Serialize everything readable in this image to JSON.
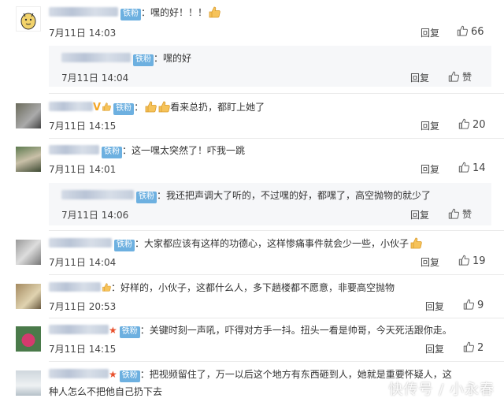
{
  "badge_label": "铁粉",
  "reply_label": "回复",
  "like_label": "赞",
  "comments": [
    {
      "text": "：嘿的好！！！",
      "time": "7月11日 14:03",
      "likes": "66"
    },
    {
      "text": "：嘿的好",
      "time": "7月11日 14:04"
    },
    {
      "text": "看来总扔，都盯上她了",
      "time": "7月11日 14:15",
      "likes": "20"
    },
    {
      "text": "：这一嘿太突然了！吓我一跳",
      "time": "7月11日 14:01",
      "likes": "14"
    },
    {
      "text": "：我还把声调大了听的，不过嘿的好，都嘿了，高空抛物的就少了",
      "time": "7月11日 14:06"
    },
    {
      "text": "：大家都应该有这样的功德心，这样惨痛事件就会少一些，小伙子",
      "time": "7月11日 14:04",
      "likes": "19"
    },
    {
      "text": "：好样的，小伙子，这都什么人，多下趟楼都不愿意，非要高空抛物",
      "time": "7月11日 20:53",
      "likes": "9"
    },
    {
      "text": "：关键时刻一声吼，吓得对方手一抖。扭头一看是帅哥，今天死活跟你走。",
      "time": "7月11日 14:15",
      "likes": "2"
    },
    {
      "text_line1": "：把视频留住了，万一以后这个地方有东西砸到人，她就是重要怀疑人，这",
      "text_line2": "种人怎么不把他自己扔下去"
    }
  ],
  "watermark": "快传号 / 小永春"
}
